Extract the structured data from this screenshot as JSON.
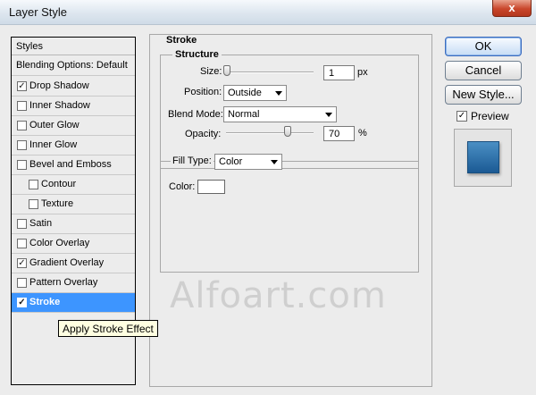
{
  "window": {
    "title": "Layer Style",
    "close_glyph": "x"
  },
  "styles_list": {
    "header": "Styles",
    "blending_label": "Blending Options: Default",
    "items": [
      {
        "label": "Drop Shadow",
        "checked": true
      },
      {
        "label": "Inner Shadow",
        "checked": false
      },
      {
        "label": "Outer Glow",
        "checked": false
      },
      {
        "label": "Inner Glow",
        "checked": false
      },
      {
        "label": "Bevel and Emboss",
        "checked": false
      },
      {
        "label": "Contour",
        "checked": false
      },
      {
        "label": "Texture",
        "checked": false
      },
      {
        "label": "Satin",
        "checked": false
      },
      {
        "label": "Color Overlay",
        "checked": false
      },
      {
        "label": "Gradient Overlay",
        "checked": true
      },
      {
        "label": "Pattern Overlay",
        "checked": false
      },
      {
        "label": "Stroke",
        "checked": true,
        "selected": true
      }
    ]
  },
  "stroke": {
    "title": "Stroke",
    "structure_title": "Structure",
    "size": {
      "label": "Size:",
      "value": "1",
      "unit": "px"
    },
    "position": {
      "label": "Position:",
      "value": "Outside"
    },
    "blend_mode": {
      "label": "Blend Mode:",
      "value": "Normal"
    },
    "opacity": {
      "label": "Opacity:",
      "value": "70",
      "unit": "%"
    },
    "fill_type": {
      "label": "Fill Type:",
      "value": "Color"
    },
    "color": {
      "label": "Color:",
      "swatch": "#ffffff"
    }
  },
  "buttons": {
    "ok": "OK",
    "cancel": "Cancel",
    "new_style": "New Style..."
  },
  "preview": {
    "label": "Preview",
    "checked": true
  },
  "watermark": "Alfoart.com",
  "tooltip": "Apply Stroke Effect",
  "colors": {
    "selection": "#3d95ff",
    "preview_fill": "#1b5a94"
  }
}
